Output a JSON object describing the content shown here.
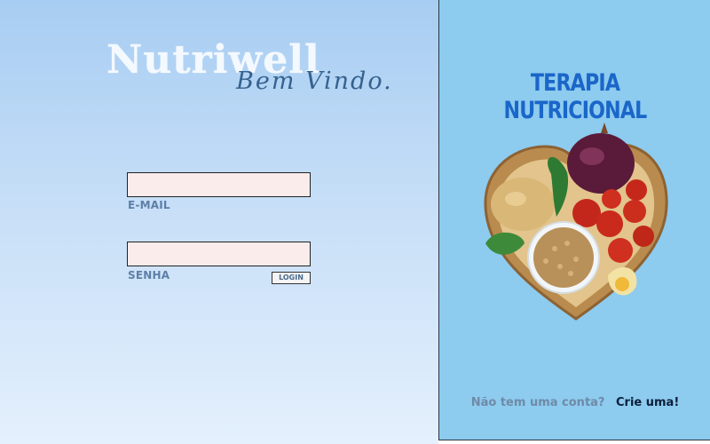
{
  "brand": {
    "name": "Nutriwell",
    "tagline": "Bem Vindo."
  },
  "login_form": {
    "email": {
      "value": "",
      "label": "E-MAIL"
    },
    "password": {
      "value": "",
      "label": "SENHA"
    },
    "login_label": "LOGIN"
  },
  "promo": {
    "title": "TERAPIA NUTRICIONAL",
    "image_icon": "heart-food-bowl-icon"
  },
  "signup": {
    "prompt": "Não tem uma conta?",
    "link": "Crie uma!"
  },
  "colors": {
    "left_bg": "#c6def7",
    "right_bg": "#8dcbef",
    "title_blue": "#1a66c9",
    "field_bg": "#fbecec",
    "label": "#5d7fa7"
  }
}
